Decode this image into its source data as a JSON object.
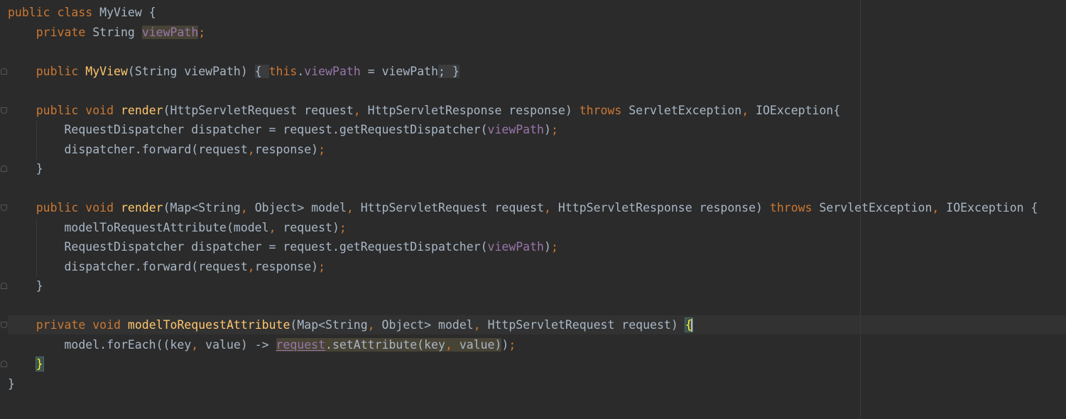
{
  "editor": {
    "lines": [
      [
        {
          "t": "public ",
          "c": "kw"
        },
        {
          "t": "class ",
          "c": "kw"
        },
        {
          "t": "MyView {",
          "c": "pl"
        }
      ],
      [
        {
          "t": "    ",
          "c": "pl"
        },
        {
          "t": "private ",
          "c": "kw"
        },
        {
          "t": "String ",
          "c": "pl"
        },
        {
          "t": "viewPath",
          "c": "fld hl-read"
        },
        {
          "t": ";",
          "c": "cm"
        }
      ],
      [],
      [
        {
          "t": "    ",
          "c": "pl"
        },
        {
          "t": "public ",
          "c": "kw"
        },
        {
          "t": "MyView",
          "c": "fn"
        },
        {
          "t": "(String viewPath) ",
          "c": "pl"
        },
        {
          "t": "{ ",
          "c": "fold-bg"
        },
        {
          "t": "this",
          "c": "kw"
        },
        {
          "t": ".",
          "c": "pl"
        },
        {
          "t": "viewPath",
          "c": "fld"
        },
        {
          "t": " = viewPath",
          "c": "pl"
        },
        {
          "t": "; ",
          "c": "cm fold-bg"
        },
        {
          "t": "}",
          "c": "fold-bg"
        }
      ],
      [],
      [
        {
          "t": "    ",
          "c": "pl"
        },
        {
          "t": "public ",
          "c": "kw"
        },
        {
          "t": "void ",
          "c": "kw"
        },
        {
          "t": "render",
          "c": "fn"
        },
        {
          "t": "(HttpServletRequest request",
          "c": "pl"
        },
        {
          "t": ", ",
          "c": "cm"
        },
        {
          "t": "HttpServletResponse response) ",
          "c": "pl"
        },
        {
          "t": "throws ",
          "c": "kw"
        },
        {
          "t": "ServletException",
          "c": "pl"
        },
        {
          "t": ", ",
          "c": "cm"
        },
        {
          "t": "IOException{",
          "c": "pl"
        }
      ],
      [
        {
          "t": "        RequestDispatcher dispatcher = request.getRequestDispatcher(",
          "c": "pl"
        },
        {
          "t": "viewPath",
          "c": "fld"
        },
        {
          "t": ")",
          "c": "pl"
        },
        {
          "t": ";",
          "c": "cm"
        }
      ],
      [
        {
          "t": "        dispatcher.forward(request",
          "c": "pl"
        },
        {
          "t": ",",
          "c": "cm"
        },
        {
          "t": "response)",
          "c": "pl"
        },
        {
          "t": ";",
          "c": "cm"
        }
      ],
      [
        {
          "t": "    }",
          "c": "pl"
        }
      ],
      [],
      [
        {
          "t": "    ",
          "c": "pl"
        },
        {
          "t": "public ",
          "c": "kw"
        },
        {
          "t": "void ",
          "c": "kw"
        },
        {
          "t": "render",
          "c": "fn"
        },
        {
          "t": "(Map<String",
          "c": "pl"
        },
        {
          "t": ", ",
          "c": "cm"
        },
        {
          "t": "Object> model",
          "c": "pl"
        },
        {
          "t": ", ",
          "c": "cm"
        },
        {
          "t": "HttpServletRequest request",
          "c": "pl"
        },
        {
          "t": ", ",
          "c": "cm"
        },
        {
          "t": "HttpServletResponse response) ",
          "c": "pl"
        },
        {
          "t": "throws ",
          "c": "kw"
        },
        {
          "t": "ServletException",
          "c": "pl"
        },
        {
          "t": ", ",
          "c": "cm"
        },
        {
          "t": "IOException {",
          "c": "pl"
        }
      ],
      [
        {
          "t": "        modelToRequestAttribute(model",
          "c": "pl"
        },
        {
          "t": ", ",
          "c": "cm"
        },
        {
          "t": "request)",
          "c": "pl"
        },
        {
          "t": ";",
          "c": "cm"
        }
      ],
      [
        {
          "t": "        RequestDispatcher dispatcher = request.getRequestDispatcher(",
          "c": "pl"
        },
        {
          "t": "viewPath",
          "c": "fld"
        },
        {
          "t": ")",
          "c": "pl"
        },
        {
          "t": ";",
          "c": "cm"
        }
      ],
      [
        {
          "t": "        dispatcher.forward(request",
          "c": "pl"
        },
        {
          "t": ",",
          "c": "cm"
        },
        {
          "t": "response)",
          "c": "pl"
        },
        {
          "t": ";",
          "c": "cm"
        }
      ],
      [
        {
          "t": "    }",
          "c": "pl"
        }
      ],
      [],
      [
        {
          "t": "    ",
          "c": "pl"
        },
        {
          "t": "private ",
          "c": "kw"
        },
        {
          "t": "void ",
          "c": "kw"
        },
        {
          "t": "modelToRequestAttribute",
          "c": "fn"
        },
        {
          "t": "(Map<String",
          "c": "pl"
        },
        {
          "t": ", ",
          "c": "cm"
        },
        {
          "t": "Object> model",
          "c": "pl"
        },
        {
          "t": ", ",
          "c": "cm"
        },
        {
          "t": "HttpServletRequest request) ",
          "c": "pl"
        },
        {
          "t": "{",
          "c": "brace-match"
        }
      ],
      [
        {
          "t": "        model.forEach((key",
          "c": "pl"
        },
        {
          "t": ", ",
          "c": "cm"
        },
        {
          "t": "value) -> ",
          "c": "pl"
        },
        {
          "t": "request",
          "c": "fld hl-var"
        },
        {
          "t": ".setAttribute(key",
          "c": "pl hl-read"
        },
        {
          "t": ", ",
          "c": "cm hl-read"
        },
        {
          "t": "value)",
          "c": "pl hl-read"
        },
        {
          "t": ")",
          "c": "pl"
        },
        {
          "t": ";",
          "c": "cm"
        }
      ],
      [
        {
          "t": "    ",
          "c": "pl"
        },
        {
          "t": "}",
          "c": "brace-match"
        }
      ],
      [
        {
          "t": "}",
          "c": "pl"
        }
      ]
    ]
  }
}
